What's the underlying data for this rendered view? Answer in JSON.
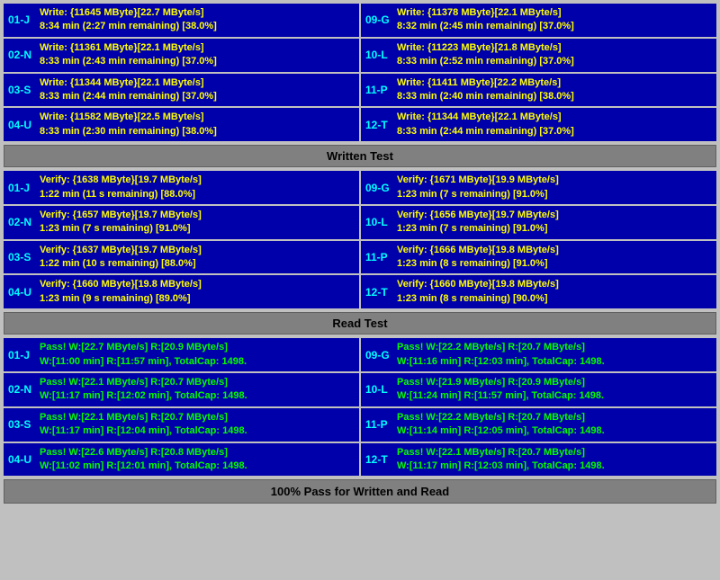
{
  "sections": {
    "write_header": "Written Test",
    "read_header": "Read Test",
    "footer": "100% Pass for Written and Read"
  },
  "write_rows": [
    {
      "left_label": "01-J",
      "left_line1": "Write: {11645 MByte}[22.7 MByte/s]",
      "left_line2": "8:34 min (2:27 min remaining)  [38.0%]",
      "right_label": "09-G",
      "right_line1": "Write: {11378 MByte}[22.1 MByte/s]",
      "right_line2": "8:32 min (2:45 min remaining)  [37.0%]"
    },
    {
      "left_label": "02-N",
      "left_line1": "Write: {11361 MByte}[22.1 MByte/s]",
      "left_line2": "8:33 min (2:43 min remaining)  [37.0%]",
      "right_label": "10-L",
      "right_line1": "Write: {11223 MByte}[21.8 MByte/s]",
      "right_line2": "8:33 min (2:52 min remaining)  [37.0%]"
    },
    {
      "left_label": "03-S",
      "left_line1": "Write: {11344 MByte}[22.1 MByte/s]",
      "left_line2": "8:33 min (2:44 min remaining)  [37.0%]",
      "right_label": "11-P",
      "right_line1": "Write: {11411 MByte}[22.2 MByte/s]",
      "right_line2": "8:33 min (2:40 min remaining)  [38.0%]"
    },
    {
      "left_label": "04-U",
      "left_line1": "Write: {11582 MByte}[22.5 MByte/s]",
      "left_line2": "8:33 min (2:30 min remaining)  [38.0%]",
      "right_label": "12-T",
      "right_line1": "Write: {11344 MByte}[22.1 MByte/s]",
      "right_line2": "8:33 min (2:44 min remaining)  [37.0%]"
    }
  ],
  "verify_rows": [
    {
      "left_label": "01-J",
      "left_line1": "Verify: {1638 MByte}[19.7 MByte/s]",
      "left_line2": "1:22 min (11 s remaining)   [88.0%]",
      "right_label": "09-G",
      "right_line1": "Verify: {1671 MByte}[19.9 MByte/s]",
      "right_line2": "1:23 min (7 s remaining)   [91.0%]"
    },
    {
      "left_label": "02-N",
      "left_line1": "Verify: {1657 MByte}[19.7 MByte/s]",
      "left_line2": "1:23 min (7 s remaining)   [91.0%]",
      "right_label": "10-L",
      "right_line1": "Verify: {1656 MByte}[19.7 MByte/s]",
      "right_line2": "1:23 min (7 s remaining)   [91.0%]"
    },
    {
      "left_label": "03-S",
      "left_line1": "Verify: {1637 MByte}[19.7 MByte/s]",
      "left_line2": "1:22 min (10 s remaining)   [88.0%]",
      "right_label": "11-P",
      "right_line1": "Verify: {1666 MByte}[19.8 MByte/s]",
      "right_line2": "1:23 min (8 s remaining)   [91.0%]"
    },
    {
      "left_label": "04-U",
      "left_line1": "Verify: {1660 MByte}[19.8 MByte/s]",
      "left_line2": "1:23 min (9 s remaining)   [89.0%]",
      "right_label": "12-T",
      "right_line1": "Verify: {1660 MByte}[19.8 MByte/s]",
      "right_line2": "1:23 min (8 s remaining)   [90.0%]"
    }
  ],
  "pass_rows": [
    {
      "left_label": "01-J",
      "left_line1": "Pass! W:[22.7 MByte/s] R:[20.9 MByte/s]",
      "left_line2": "W:[11:00 min] R:[11:57 min], TotalCap: 1498.",
      "right_label": "09-G",
      "right_line1": "Pass! W:[22.2 MByte/s] R:[20.7 MByte/s]",
      "right_line2": "W:[11:16 min] R:[12:03 min], TotalCap: 1498."
    },
    {
      "left_label": "02-N",
      "left_line1": "Pass! W:[22.1 MByte/s] R:[20.7 MByte/s]",
      "left_line2": "W:[11:17 min] R:[12:02 min], TotalCap: 1498.",
      "right_label": "10-L",
      "right_line1": "Pass! W:[21.9 MByte/s] R:[20.9 MByte/s]",
      "right_line2": "W:[11:24 min] R:[11:57 min], TotalCap: 1498."
    },
    {
      "left_label": "03-S",
      "left_line1": "Pass! W:[22.1 MByte/s] R:[20.7 MByte/s]",
      "left_line2": "W:[11:17 min] R:[12:04 min], TotalCap: 1498.",
      "right_label": "11-P",
      "right_line1": "Pass! W:[22.2 MByte/s] R:[20.7 MByte/s]",
      "right_line2": "W:[11:14 min] R:[12:05 min], TotalCap: 1498."
    },
    {
      "left_label": "04-U",
      "left_line1": "Pass! W:[22.6 MByte/s] R:[20.8 MByte/s]",
      "left_line2": "W:[11:02 min] R:[12:01 min], TotalCap: 1498.",
      "right_label": "12-T",
      "right_line1": "Pass! W:[22.1 MByte/s] R:[20.7 MByte/s]",
      "right_line2": "W:[11:17 min] R:[12:03 min], TotalCap: 1498."
    }
  ]
}
